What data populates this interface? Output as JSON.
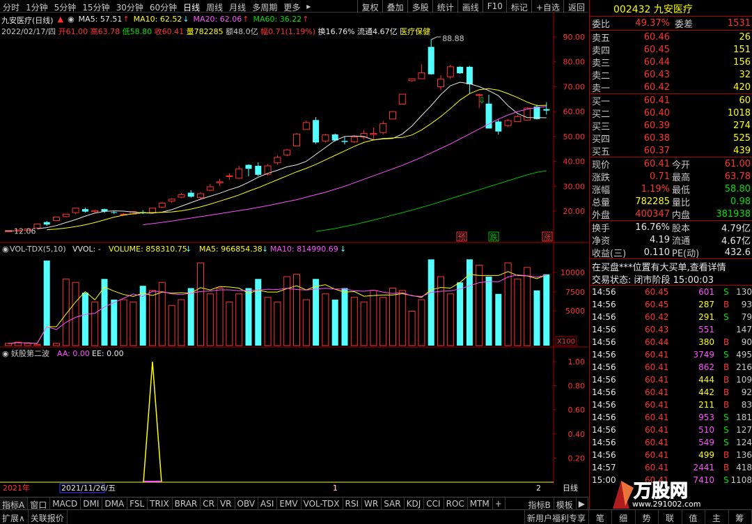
{
  "periods": [
    "分时",
    "1分钟",
    "5分钟",
    "15分钟",
    "30分钟",
    "60分钟",
    "日线",
    "周线",
    "月线",
    "多周期",
    "更多"
  ],
  "active_period": "日线",
  "toolbar": [
    "复权",
    "叠加",
    "多股",
    "统计",
    "画线",
    "F10",
    "标记",
    "+自选",
    "返回"
  ],
  "stock": {
    "code": "002432",
    "name": "九安医疗"
  },
  "header": {
    "title": "九安医疗(日线)",
    "ma5": "MA5: 57.51",
    "ma10": "MA10: 62.52",
    "ma20": "MA20: 62.06",
    "ma60": "MA60: 36.22",
    "date": "2022/02/17/四",
    "open": "开61.00",
    "high": "高63.78",
    "low": "低58.80",
    "close": "收60.41",
    "volume": "量782285",
    "amount": "额48.0亿",
    "change": "幅0.71(1.19%)",
    "turnover": "换16.76%",
    "float_cap": "流通4.67亿",
    "sector": "医疗保健"
  },
  "price_axis": [
    "90.00",
    "80.00",
    "70.00",
    "60.00",
    "50.00",
    "40.00",
    "30.00",
    "20.00"
  ],
  "price_annotations": {
    "high": "88.88",
    "low": "12.06"
  },
  "signals": [
    "预",
    "跌",
    "涨"
  ],
  "vol_header": {
    "name": "VOL-TDX(5,10)",
    "vvol": "VVOL: -",
    "volume": "VOLUME: 858310.75",
    "ma5": "MA5: 966854.38",
    "ma10": "MA10: 814990.69"
  },
  "vol_axis": [
    "10000",
    "7500",
    "5000"
  ],
  "vol_unit": "X100",
  "ind_header": {
    "name": "妖股第二波",
    "aa": "AA: 0.00",
    "ee": "EE: 0.00"
  },
  "ind_axis": [
    "1.00",
    "0.80",
    "0.60",
    "0.40",
    "0.20"
  ],
  "time_axis": {
    "year": "2021年",
    "date": "2021/11/26/五",
    "m1": "1",
    "m2": "2",
    "period": "日线"
  },
  "indicator_tabs": [
    "指标A",
    "窗口",
    "MACD",
    "DMI",
    "DMA",
    "FSL",
    "TRIX",
    "BRAR",
    "CR",
    "VR",
    "OBV",
    "ASI",
    "EMV",
    "VOL-TDX",
    "RSI",
    "WR",
    "SAR",
    "KDJ",
    "CCI",
    "ROC",
    "MTM",
    "+",
    "指标B",
    "模板",
    "▶"
  ],
  "bottom_tabs": [
    "扩展∧",
    "关联报价"
  ],
  "bottom_right": [
    "新用户福利专享"
  ],
  "bottom_right_tabs": [
    "笔",
    "细",
    "势",
    "联",
    "值",
    "主",
    "筹"
  ],
  "orderbook": {
    "weibi_label": "委比",
    "weibi": "49.37%",
    "weicha_label": "委差",
    "weicha": "1531",
    "asks": [
      {
        "label": "卖五",
        "price": "60.46",
        "vol": "26"
      },
      {
        "label": "卖四",
        "price": "60.45",
        "vol": "151"
      },
      {
        "label": "卖三",
        "price": "60.44",
        "vol": "156"
      },
      {
        "label": "卖二",
        "price": "60.43",
        "vol": "32"
      },
      {
        "label": "卖一",
        "price": "60.42",
        "vol": "420"
      }
    ],
    "bids": [
      {
        "label": "买一",
        "price": "60.41",
        "vol": "60"
      },
      {
        "label": "买二",
        "price": "60.40",
        "vol": "1018"
      },
      {
        "label": "买三",
        "price": "60.39",
        "vol": "274"
      },
      {
        "label": "买四",
        "price": "60.38",
        "vol": "525"
      },
      {
        "label": "买五",
        "price": "60.37",
        "vol": "439"
      }
    ]
  },
  "quote": [
    {
      "l1": "现价",
      "v1": "60.41",
      "c1": "red",
      "l2": "今开",
      "v2": "61.00",
      "c2": "red"
    },
    {
      "l1": "涨跌",
      "v1": "0.71",
      "c1": "red",
      "l2": "最高",
      "v2": "63.78",
      "c2": "red"
    },
    {
      "l1": "涨幅",
      "v1": "1.19%",
      "c1": "red",
      "l2": "最低",
      "v2": "58.80",
      "c2": "green"
    },
    {
      "l1": "总量",
      "v1": "782285",
      "c1": "yel",
      "l2": "量比",
      "v2": "0.98",
      "c2": "green"
    },
    {
      "l1": "外盘",
      "v1": "400347",
      "c1": "red",
      "l2": "内盘",
      "v2": "381938",
      "c2": "green"
    }
  ],
  "fund": [
    {
      "l1": "换手",
      "v1": "16.76%",
      "l2": "股本",
      "v2": "4.79亿"
    },
    {
      "l1": "净资",
      "v1": "4.19",
      "l2": "流通",
      "v2": "4.67亿"
    },
    {
      "l1": "收益(三)",
      "v1": "0.110",
      "l2": "PE(动)",
      "v2": "432.6"
    }
  ],
  "notice": "在买盘***位置有大买单,查看详情",
  "trade_status": "交易状态: 闭市阶段 15:00:03",
  "ticks": [
    {
      "t": "14:56",
      "p": "60.45",
      "v": "601",
      "bs": "S",
      "n": "130"
    },
    {
      "t": "14:56",
      "p": "60.45",
      "v": "287",
      "bs": "B",
      "n": "93"
    },
    {
      "t": "14:56",
      "p": "60.42",
      "v": "291",
      "bs": "S",
      "n": "79"
    },
    {
      "t": "14:56",
      "p": "60.43",
      "v": "551",
      "bs": "",
      "n": "147"
    },
    {
      "t": "14:56",
      "p": "60.44",
      "v": "380",
      "bs": "B",
      "n": "90"
    },
    {
      "t": "14:56",
      "p": "60.41",
      "v": "3749",
      "bs": "S",
      "n": "495"
    },
    {
      "t": "14:56",
      "p": "60.41",
      "v": "862",
      "bs": "B",
      "n": "216"
    },
    {
      "t": "14:56",
      "p": "60.41",
      "v": "444",
      "bs": "B",
      "n": "109"
    },
    {
      "t": "14:56",
      "p": "60.41",
      "v": "442",
      "bs": "B",
      "n": "92"
    },
    {
      "t": "14:56",
      "p": "60.41",
      "v": "211",
      "bs": "B",
      "n": "83"
    },
    {
      "t": "14:56",
      "p": "60.41",
      "v": "953",
      "bs": "S",
      "n": "181"
    },
    {
      "t": "14:56",
      "p": "60.41",
      "v": "510",
      "bs": "S",
      "n": "127"
    },
    {
      "t": "14:56",
      "p": "60.41",
      "v": "549",
      "bs": "S",
      "n": "124"
    },
    {
      "t": "14:56",
      "p": "60.41",
      "v": "499",
      "bs": "B",
      "n": "136"
    },
    {
      "t": "14:57",
      "p": "60.41",
      "v": "2441",
      "bs": "B",
      "n": "418"
    },
    {
      "t": "15:00",
      "p": "60.41",
      "v": "7410",
      "bs": "S",
      "n": "1108"
    }
  ],
  "watermark": "万股网",
  "watermark_url": "www.291002.com",
  "chart_data": {
    "type": "candlestick",
    "title": "九安医疗(日线)",
    "candles": [
      [
        11.7,
        12.2,
        11.5,
        12.0
      ],
      [
        12.0,
        12.4,
        11.8,
        12.2
      ],
      [
        12.2,
        12.9,
        12.0,
        12.8
      ],
      [
        13.2,
        14.8,
        13.0,
        14.6
      ],
      [
        15.6,
        14.6,
        14.0,
        16.0
      ],
      [
        16.2,
        17.6,
        16.0,
        17.5
      ],
      [
        17.8,
        18.8,
        17.5,
        18.6
      ],
      [
        19.4,
        21.2,
        18.8,
        20.8
      ],
      [
        20.8,
        19.8,
        19.4,
        21.4
      ],
      [
        19.8,
        20.2,
        19.2,
        20.6
      ],
      [
        20.8,
        19.9,
        19.2,
        21.0
      ],
      [
        19.6,
        19.4,
        18.8,
        20.0
      ],
      [
        18.6,
        18.8,
        18.2,
        19.2
      ],
      [
        18.8,
        19.8,
        18.6,
        20.0
      ],
      [
        19.6,
        19.2,
        18.8,
        20.4
      ],
      [
        19.4,
        21.2,
        19.0,
        21.4
      ],
      [
        21.6,
        23.2,
        21.2,
        23.6
      ],
      [
        24.0,
        24.8,
        23.4,
        25.2
      ],
      [
        25.6,
        26.6,
        25.2,
        27.2
      ],
      [
        27.4,
        25.8,
        25.4,
        28.4
      ],
      [
        25.4,
        27.0,
        24.8,
        27.6
      ],
      [
        28.4,
        29.8,
        28.0,
        31.0
      ],
      [
        31.4,
        31.8,
        30.0,
        33.0
      ],
      [
        34.0,
        34.2,
        32.6,
        35.2
      ],
      [
        33.2,
        37.0,
        33.0,
        38.2
      ],
      [
        38.6,
        37.0,
        34.0,
        38.8
      ],
      [
        38.2,
        34.6,
        34.0,
        39.6
      ],
      [
        34.8,
        38.2,
        34.2,
        39.0
      ],
      [
        39.4,
        41.6,
        38.6,
        42.4
      ],
      [
        42.6,
        44.6,
        42.0,
        45.0
      ],
      [
        46.2,
        51.0,
        46.0,
        51.4
      ],
      [
        52.8,
        55.6,
        52.6,
        56.4
      ],
      [
        56.6,
        47.6,
        47.0,
        57.8
      ],
      [
        48.2,
        50.6,
        47.6,
        51.0
      ],
      [
        50.8,
        48.4,
        48.0,
        51.2
      ],
      [
        48.2,
        47.8,
        46.8,
        49.8
      ],
      [
        47.8,
        49.8,
        47.4,
        50.4
      ],
      [
        49.8,
        51.2,
        48.8,
        52.6
      ],
      [
        50.8,
        51.2,
        48.4,
        53.6
      ],
      [
        51.6,
        55.2,
        50.8,
        56.2
      ],
      [
        57.0,
        60.0,
        56.8,
        60.2
      ],
      [
        63.0,
        67.0,
        63.0,
        67.2
      ],
      [
        72.4,
        73.2,
        72.0,
        73.4
      ],
      [
        73.2,
        75.6,
        75.0,
        79.0
      ],
      [
        86.0,
        75.0,
        74.8,
        88.88
      ],
      [
        70.0,
        73.0,
        68.6,
        74.6
      ],
      [
        74.0,
        78.0,
        73.2,
        78.8
      ],
      [
        78.0,
        75.4,
        75.2,
        78.2
      ],
      [
        78.0,
        71.0,
        67.2,
        78.4
      ],
      [
        66.8,
        66.8,
        61.4,
        67.2
      ],
      [
        63.2,
        53.2,
        55.0,
        66.8
      ],
      [
        56.0,
        52.0,
        50.8,
        56.8
      ],
      [
        54.4,
        56.4,
        53.8,
        57.0
      ],
      [
        56.0,
        58.0,
        56.0,
        58.6
      ],
      [
        56.6,
        61.4,
        56.4,
        61.8
      ],
      [
        62.0,
        57.0,
        56.8,
        62.8
      ],
      [
        61.0,
        60.41,
        58.8,
        63.78
      ]
    ],
    "series": [
      {
        "name": "MA5",
        "values": [
          12.9,
          13.4,
          14.2,
          15.4,
          16.6,
          18.0,
          19.2,
          19.9,
          20.1,
          20.0,
          19.6,
          19.3,
          19.2,
          19.6,
          20.6,
          22.0,
          23.4,
          24.8,
          26.0,
          27.2,
          28.6,
          29.8,
          31.6,
          33.6,
          35.2,
          36.4,
          37.8,
          38.6,
          40.0,
          42.8,
          45.6,
          48.4,
          50.0,
          50.2,
          50.0,
          48.6,
          49.0,
          49.2,
          51.0,
          54.2,
          58.4,
          62.4,
          66.8,
          70.4,
          71.8,
          71.2,
          70.0,
          68.4,
          66.4,
          62.4,
          59.2,
          57.6,
          57.6,
          57.51
        ]
      },
      {
        "name": "MA10",
        "values": [
          12.5,
          12.8,
          13.2,
          13.8,
          14.5,
          15.4,
          16.5,
          17.6,
          18.4,
          19.0,
          19.3,
          19.4,
          19.5,
          19.7,
          20.1,
          20.8,
          21.7,
          22.8,
          24.0,
          25.2,
          26.5,
          28.0,
          29.4,
          31.0,
          32.6,
          34.2,
          35.8,
          37.2,
          38.8,
          40.6,
          42.4,
          44.2,
          46.0,
          47.6,
          48.6,
          49.2,
          49.4,
          49.6,
          50.6,
          52.6,
          55.2,
          58.0,
          61.2,
          64.6,
          67.2,
          68.8,
          69.2,
          68.6,
          67.2,
          65.6,
          63.8,
          62.4,
          62.52
        ]
      },
      {
        "name": "MA20",
        "values": [
          14.5,
          15.0,
          15.5,
          16.0,
          16.6,
          17.2,
          17.8,
          18.4,
          19.0,
          19.6,
          20.2,
          20.8,
          21.5,
          22.2,
          23.0,
          23.8,
          24.6,
          25.6,
          26.6,
          27.6,
          28.8,
          30.0,
          31.4,
          32.8,
          34.2,
          35.6,
          37.0,
          38.4,
          40.0,
          41.6,
          43.4,
          45.2,
          47.0,
          49.0,
          51.0,
          53.0,
          55.0,
          57.0,
          58.6,
          60.0,
          61.0,
          61.6,
          62.06
        ]
      },
      {
        "name": "MA60",
        "values": [
          11.8,
          12.4,
          13.0,
          13.8,
          14.6,
          15.5,
          16.4,
          17.4,
          18.4,
          19.4,
          20.4,
          21.5,
          22.6,
          23.8,
          25.0,
          26.2,
          27.4,
          28.6,
          29.8,
          31.0,
          32.2,
          33.4,
          34.6,
          35.6,
          36.22
        ]
      }
    ],
    "volume": [
      2,
      3,
      2,
      1,
      74,
      2,
      58,
      55,
      46,
      38,
      58,
      40,
      40,
      38,
      52,
      48,
      55,
      35,
      40,
      50,
      72,
      45,
      50,
      38,
      45,
      50,
      58,
      42,
      38,
      60,
      62,
      40,
      58,
      45,
      40,
      50,
      42,
      38,
      48,
      42,
      50,
      48,
      30,
      40,
      75,
      60,
      45,
      55,
      75,
      70,
      60,
      45,
      72,
      58,
      68,
      48,
      62
    ],
    "indicator": {
      "name": "妖股第二波",
      "AA": 0.0,
      "EE": 0.0,
      "peak_index": 15,
      "peak_value": 1.0
    },
    "ylim": [
      10,
      95
    ]
  }
}
